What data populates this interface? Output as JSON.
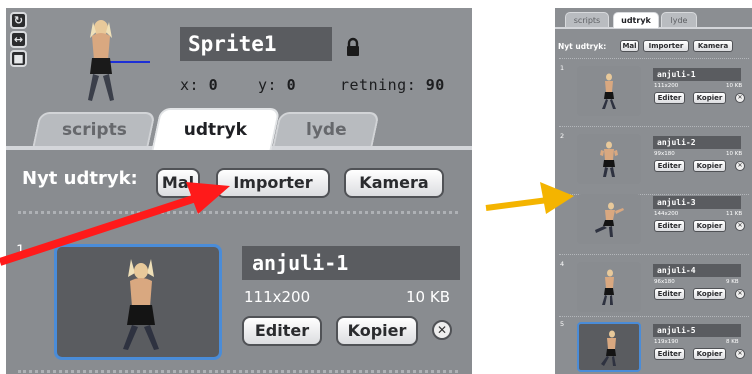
{
  "sprite": {
    "name": "Sprite1",
    "x_label": "x:",
    "x_value": "0",
    "y_label": "y:",
    "y_value": "0",
    "direction_label": "retning:",
    "direction_value": "90"
  },
  "rotation_buttons": [
    "rotate-icon",
    "flip-icon",
    "no-rotate-icon"
  ],
  "tabs": [
    {
      "label": "scripts",
      "active": false
    },
    {
      "label": "udtryk",
      "active": true
    },
    {
      "label": "lyde",
      "active": false
    }
  ],
  "new_costume": {
    "label": "Nyt udtryk:",
    "buttons": [
      "Mal",
      "Importer",
      "Kamera"
    ]
  },
  "costume_buttons": {
    "edit": "Editer",
    "copy": "Kopier",
    "delete": "✕"
  },
  "costumes": [
    {
      "index": "1",
      "name": "anjuli-1",
      "dimensions": "111x200",
      "size": "10 KB"
    },
    {
      "index": "2",
      "name": "anjuli-2",
      "dimensions": "99x180",
      "size": "10 KB"
    },
    {
      "index": "3",
      "name": "anjuli-3",
      "dimensions": "144x200",
      "size": "11 KB"
    },
    {
      "index": "4",
      "name": "anjuli-4",
      "dimensions": "96x180",
      "size": "9 KB"
    },
    {
      "index": "5",
      "name": "anjuli-5",
      "dimensions": "119x190",
      "size": "8 KB"
    }
  ],
  "colors": {
    "annotation_red_arrow": "#ff1a1a",
    "annotation_orange_arrow": "#f4b400",
    "selection_blue": "#4a8cd8",
    "panel_gray": "#8e9195"
  }
}
